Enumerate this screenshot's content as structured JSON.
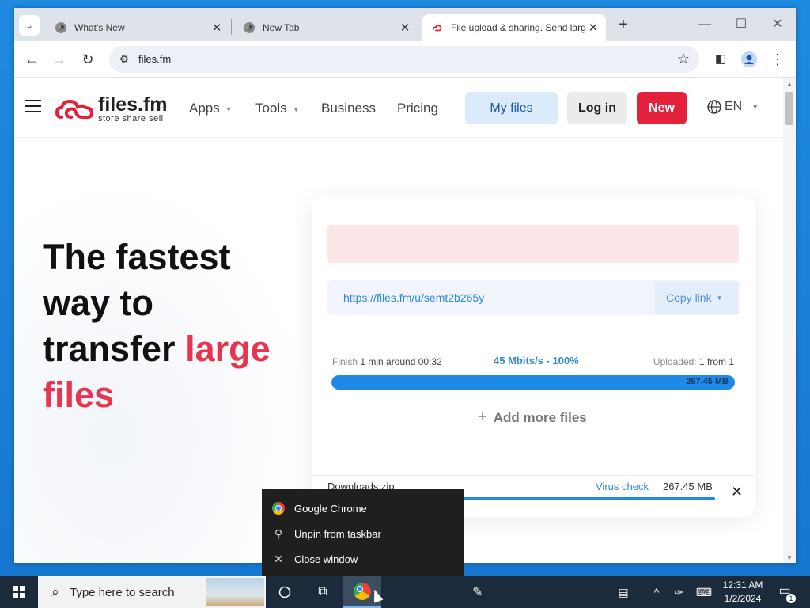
{
  "browser": {
    "tabs": [
      {
        "title": "What's New"
      },
      {
        "title": "New Tab"
      },
      {
        "title": "File upload & sharing. Send large files"
      }
    ],
    "address": "files.fm"
  },
  "site": {
    "logo_name": "files.fm",
    "logo_tagline": "store share sell",
    "nav": {
      "apps": "Apps",
      "tools": "Tools",
      "business": "Business",
      "pricing": "Pricing"
    },
    "buttons": {
      "my_files": "My files",
      "login": "Log in",
      "new": "New"
    },
    "language": "EN",
    "brand_red": "#e4213a"
  },
  "hero": {
    "line1": "The fastest",
    "line2": "way to",
    "line3": "transfer",
    "highlight1": "large",
    "highlight2": "files"
  },
  "upload": {
    "share_url": "https://files.fm/u/semt2b265y",
    "copy_label": "Copy link",
    "finish_label": "Finish",
    "finish_value": "1 min around 00:32",
    "speed": "45 Mbits/s - 100%",
    "uploaded_label": "Uploaded:",
    "uploaded_value": "1 from 1",
    "progress_percent": 100,
    "progress_size": "267.45 MB",
    "add_more": "Add more files",
    "file_name": "Downloads.zip",
    "virus_check": "Virus check",
    "file_size": "267.45 MB"
  },
  "jumplist": {
    "items": [
      "Google Chrome",
      "Unpin from taskbar",
      "Close window"
    ]
  },
  "taskbar": {
    "search_placeholder": "Type here to search",
    "time": "12:31 AM",
    "date": "1/2/2024",
    "notification_count": "1"
  }
}
